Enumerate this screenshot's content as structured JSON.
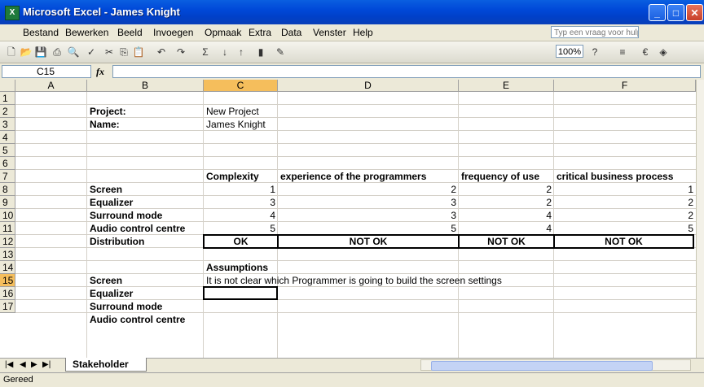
{
  "window": {
    "title": "Microsoft Excel - James Knight",
    "app_icon": "excel-icon"
  },
  "menu": [
    "Bestand",
    "Bewerken",
    "Beeld",
    "Invoegen",
    "Opmaak",
    "Extra",
    "Data",
    "Venster",
    "Help"
  ],
  "help_placeholder": "Typ een vraag voor hulp",
  "toolbar": {
    "zoom": "100%"
  },
  "formula_bar": {
    "name_box": "C15",
    "formula": ""
  },
  "columns": [
    "A",
    "B",
    "C",
    "D",
    "E",
    "F"
  ],
  "rows": [
    "1",
    "2",
    "3",
    "4",
    "5",
    "6",
    "7",
    "8",
    "9",
    "10",
    "11",
    "12",
    "13",
    "14",
    "15",
    "16",
    "17"
  ],
  "sheet": {
    "project_label": "Project:",
    "project_value": "New Project",
    "name_label": "Name:",
    "name_value": "James Knight",
    "headers": [
      "Complexity",
      "experience of the programmers",
      "frequency of use",
      "critical business process"
    ],
    "items": [
      {
        "label": "Screen",
        "values": [
          "1",
          "2",
          "2",
          "1"
        ]
      },
      {
        "label": "Equalizer",
        "values": [
          "3",
          "3",
          "2",
          "2"
        ]
      },
      {
        "label": "Surround mode",
        "values": [
          "4",
          "3",
          "4",
          "2"
        ]
      },
      {
        "label": "Audio control centre",
        "values": [
          "5",
          "5",
          "4",
          "5"
        ]
      }
    ],
    "distribution_label": "Distribution",
    "distribution": [
      "OK",
      "NOT OK",
      "NOT OK",
      "NOT OK"
    ],
    "assumptions_title": "Assumptions",
    "assumptions": [
      {
        "label": "Screen",
        "text": "It is not clear which Programmer is going to build the screen settings"
      },
      {
        "label": "Equalizer",
        "text": ""
      },
      {
        "label": "Surround mode",
        "text": ""
      },
      {
        "label": "Audio control centre",
        "text": ""
      }
    ]
  },
  "sheet_tab": "Stakeholder",
  "status": "Gereed"
}
